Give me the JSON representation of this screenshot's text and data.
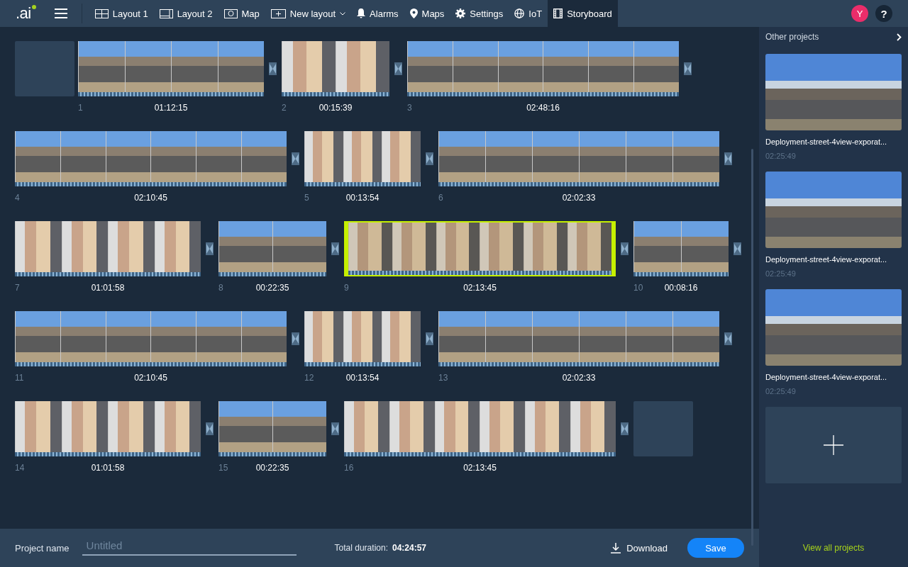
{
  "nav": {
    "logo": ".ai",
    "items": [
      {
        "label": "Layout 1",
        "selected": false,
        "dropdown": false
      },
      {
        "label": "Layout 2",
        "selected": false,
        "dropdown": false
      },
      {
        "label": "Map",
        "selected": false,
        "dropdown": false
      },
      {
        "label": "New layout",
        "selected": false,
        "dropdown": true
      },
      {
        "label": "Alarms",
        "selected": false,
        "dropdown": false
      },
      {
        "label": "Maps",
        "selected": false,
        "dropdown": false
      },
      {
        "label": "Settings",
        "selected": false,
        "dropdown": false
      },
      {
        "label": "IoT",
        "selected": false,
        "dropdown": false
      },
      {
        "label": "Storyboard",
        "selected": true,
        "dropdown": false
      }
    ],
    "avatar": "Y",
    "help": "?"
  },
  "storyboard": {
    "rows": [
      [
        {
          "kind": "empty"
        },
        {
          "kind": "clip",
          "number": "1",
          "duration": "01:12:15",
          "selected": false
        },
        {
          "kind": "clip",
          "number": "2",
          "duration": "00:15:39",
          "selected": false
        },
        {
          "kind": "clip",
          "number": "3",
          "duration": "02:48:16",
          "selected": false
        }
      ],
      [
        {
          "kind": "clip",
          "number": "4",
          "duration": "02:10:45",
          "selected": false
        },
        {
          "kind": "clip",
          "number": "5",
          "duration": "00:13:54",
          "selected": false
        },
        {
          "kind": "clip",
          "number": "6",
          "duration": "02:02:33",
          "selected": false
        }
      ],
      [
        {
          "kind": "clip",
          "number": "7",
          "duration": "01:01:58",
          "selected": false
        },
        {
          "kind": "clip",
          "number": "8",
          "duration": "00:22:35",
          "selected": false
        },
        {
          "kind": "clip",
          "number": "9",
          "duration": "02:13:45",
          "selected": true
        },
        {
          "kind": "clip",
          "number": "10",
          "duration": "00:08:16",
          "selected": false
        }
      ],
      [
        {
          "kind": "clip",
          "number": "11",
          "duration": "02:10:45",
          "selected": false
        },
        {
          "kind": "clip",
          "number": "12",
          "duration": "00:13:54",
          "selected": false
        },
        {
          "kind": "clip",
          "number": "13",
          "duration": "02:02:33",
          "selected": false
        }
      ],
      [
        {
          "kind": "clip",
          "number": "14",
          "duration": "01:01:58",
          "selected": false
        },
        {
          "kind": "clip",
          "number": "15",
          "duration": "00:22:35",
          "selected": false
        },
        {
          "kind": "clip",
          "number": "16",
          "duration": "02:13:45",
          "selected": false
        },
        {
          "kind": "empty"
        }
      ]
    ]
  },
  "footer": {
    "project_label": "Project name",
    "project_name": {
      "placeholder": "Untitled"
    },
    "total_label": "Total duration:",
    "total": "04:24:57",
    "download": "Download",
    "save": "Save"
  },
  "sidebar": {
    "title": "Other projects",
    "projects": [
      {
        "name": "Deployment-street-4view-exporat...",
        "duration": "02:25:49"
      },
      {
        "name": "Deployment-street-4view-exporat...",
        "duration": "02:25:49"
      },
      {
        "name": "Deployment-street-4view-exporat...",
        "duration": "02:25:49"
      }
    ],
    "view_all": "View all projects"
  }
}
